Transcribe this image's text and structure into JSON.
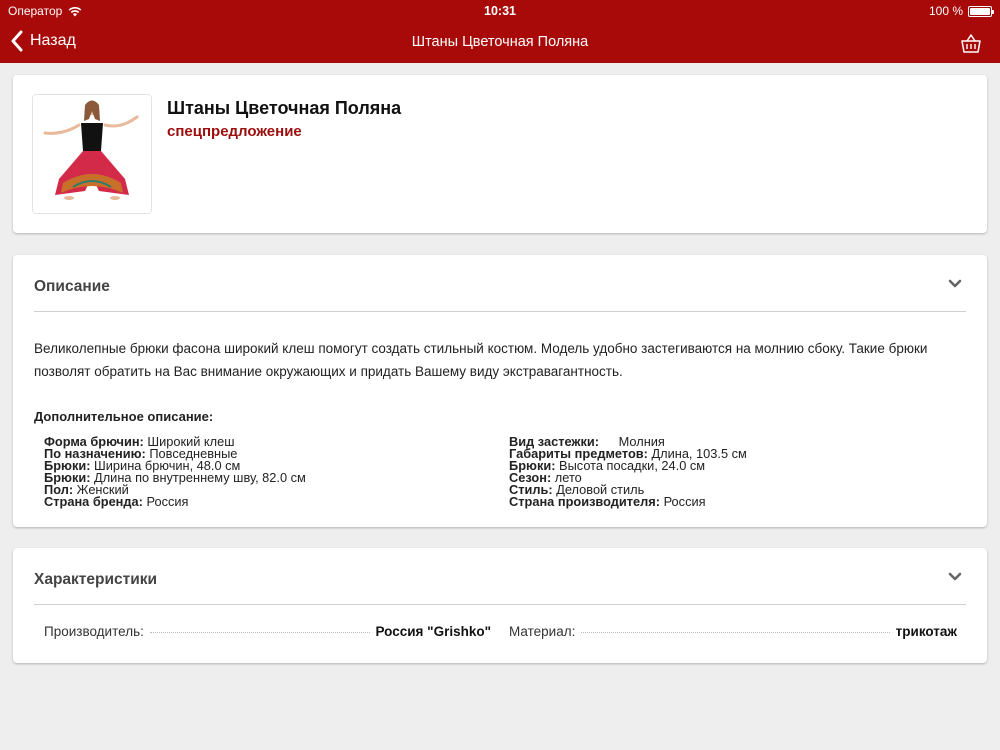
{
  "status_bar": {
    "carrier": "Оператор",
    "time": "10:31",
    "battery": "100 %"
  },
  "nav": {
    "back_label": "Назад",
    "title": "Штаны Цветочная Поляна"
  },
  "product": {
    "name": "Штаны Цветочная Поляна",
    "badge": "спецпредложение"
  },
  "description": {
    "title": "Описание",
    "text": "Великолепные брюки фасона широкий клеш помогут создать стильный костюм. Модель удобно застегиваются на молнию сбоку. Такие брюки позволят обратить на Вас внимание окружающих и придать Вашему виду экстравагантность.",
    "extra_title": "Дополнительное описание:",
    "left_props": [
      {
        "label": "Форма брючин:",
        "value": "Широкий клеш"
      },
      {
        "label": "По назначению:",
        "value": "Повседневные"
      },
      {
        "label": "Брюки:",
        "value": "Ширина брючин, 48.0 см"
      },
      {
        "label": "Брюки:",
        "value": "Длина по внутреннему шву, 82.0 см"
      },
      {
        "label": "Пол:",
        "value": "Женский"
      },
      {
        "label": "Страна бренда:",
        "value": "Россия"
      }
    ],
    "right_props": [
      {
        "label": "Вид застежки:",
        "value": "Молния"
      },
      {
        "label": "Габариты предметов:",
        "value": "Длина, 103.5 см"
      },
      {
        "label": "Брюки:",
        "value": "Высота посадки, 24.0 см"
      },
      {
        "label": "Сезон:",
        "value": "лето"
      },
      {
        "label": "Стиль:",
        "value": "Деловой стиль"
      },
      {
        "label": "Страна производителя:",
        "value": "Россия"
      }
    ]
  },
  "characteristics": {
    "title": "Характеристики",
    "rows": [
      {
        "label": "Производитель:",
        "value": "Россия \"Grishko\""
      },
      {
        "label": "Материал:",
        "value": "трикотаж"
      }
    ]
  },
  "colors": {
    "brand": "#a80a0a",
    "badge": "#9c0e0e",
    "background": "#eeeeee"
  }
}
